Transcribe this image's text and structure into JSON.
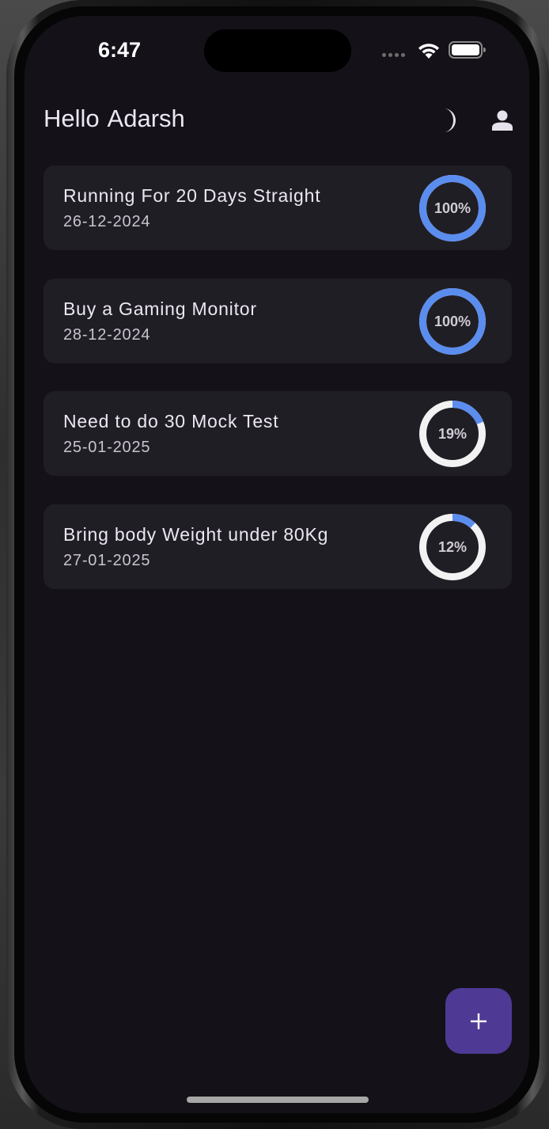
{
  "status_bar": {
    "time": "6:47",
    "icons": [
      "signal-dots-icon",
      "wifi-icon",
      "battery-icon"
    ]
  },
  "header": {
    "greeting": "Hello  Adarsh",
    "icons": [
      "moon-icon",
      "person-icon"
    ]
  },
  "goals": [
    {
      "title": "Running For 20 Days Straight",
      "date": "26-12-2024",
      "progress_label": "100%",
      "progress": 1.0
    },
    {
      "title": "Buy a Gaming Monitor",
      "date": "28-12-2024",
      "progress_label": "100%",
      "progress": 1.0
    },
    {
      "title": "Need to do 30 Mock Test",
      "date": "25-01-2025",
      "progress_label": "19%",
      "progress": 0.19
    },
    {
      "title": "Bring body Weight under 80Kg",
      "date": "27-01-2025",
      "progress_label": "12%",
      "progress": 0.12
    }
  ],
  "fab": {
    "label": "+",
    "icon": "plus-icon"
  },
  "colors": {
    "background": "#141218",
    "card": "#201e25",
    "progress_fill": "#5b8def",
    "progress_track": "#f2f2f2",
    "fab": "#4e3a95"
  }
}
